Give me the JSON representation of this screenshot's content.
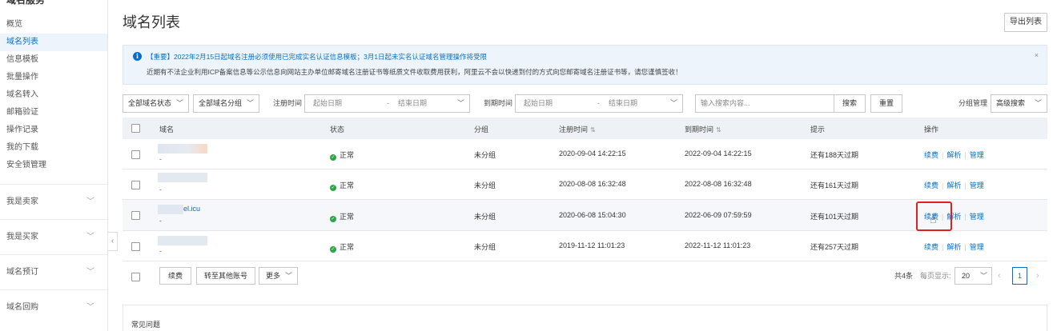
{
  "sidebar": {
    "title": "域名服务",
    "items": [
      {
        "label": "概览"
      },
      {
        "label": "域名列表"
      },
      {
        "label": "信息模板"
      },
      {
        "label": "批量操作"
      },
      {
        "label": "域名转入"
      },
      {
        "label": "邮箱验证"
      },
      {
        "label": "操作记录"
      },
      {
        "label": "我的下载"
      },
      {
        "label": "安全锁管理"
      }
    ],
    "groups": [
      {
        "label": "我是卖家"
      },
      {
        "label": "我是买家"
      },
      {
        "label": "域名预订"
      },
      {
        "label": "域名回购"
      }
    ],
    "collapse_glyph": "‹"
  },
  "header": {
    "title": "域名列表",
    "export_label": "导出列表"
  },
  "notice": {
    "icon": "info-icon",
    "line1": "【重要】2022年2月15日起域名注册必须使用已完成实名认证信息模板；3月1日起未实名认证域名管理操作将受限",
    "line2": "近期有不法企业利用ICP备案信息等公示信息向网站主办单位邮寄域名注册证书等纸质文件收取费用获利，阿里云不会以快递到付的方式向您邮寄域名注册证书等，请您谨慎签收！",
    "close": "×"
  },
  "filters": {
    "status_select": "全部域名状态",
    "group_select": "全部域名分组",
    "reg_time_label": "注册时间",
    "reg_start_placeholder": "起始日期",
    "reg_end_placeholder": "结束日期",
    "exp_time_label": "到期时间",
    "exp_start_placeholder": "起始日期",
    "exp_end_placeholder": "结束日期",
    "range_sep": "-",
    "search_placeholder": "输入搜索内容...",
    "search_label": "搜索",
    "reset_label": "重置",
    "group_manage_label": "分组管理",
    "advanced_search_label": "高级搜索"
  },
  "table": {
    "columns": [
      "域名",
      "状态",
      "分组",
      "注册时间",
      "到期时间",
      "提示",
      "操作"
    ],
    "rows": [
      {
        "domain_visible": "",
        "domain_sub": "-",
        "status": "正常",
        "group": "未分组",
        "reg": "2020-09-04 14:22:15",
        "exp": "2022-09-04 14:22:15",
        "hint": "还有188天过期"
      },
      {
        "domain_visible": "",
        "domain_sub": "-",
        "status": "正常",
        "group": "未分组",
        "reg": "2020-08-08 16:32:48",
        "exp": "2022-08-08 16:32:48",
        "hint": "还有161天过期"
      },
      {
        "domain_visible": "el.icu",
        "domain_sub": "-",
        "status": "正常",
        "group": "未分组",
        "reg": "2020-06-08 15:04:30",
        "exp": "2022-06-09 07:59:59",
        "hint": "还有101天过期"
      },
      {
        "domain_visible": "",
        "domain_sub": "-",
        "status": "正常",
        "group": "未分组",
        "reg": "2019-11-12 11:01:23",
        "exp": "2022-11-12 11:01:23",
        "hint": "还有257天过期"
      }
    ],
    "actions": {
      "renew": "续费",
      "resolve": "解析",
      "manage": "管理"
    },
    "status_color": "#2aa745"
  },
  "footer": {
    "renew_label": "续费",
    "transfer_label": "转至其他账号",
    "more_label": "更多",
    "total": "共4条",
    "per_page_label": "每页显示:",
    "per_page_value": "20",
    "page": "1",
    "prev": "‹",
    "next": "›"
  },
  "faq": {
    "title": "常见问题"
  },
  "colors": {
    "accent": "#0070cc",
    "highlight_box": "#e0201a"
  }
}
